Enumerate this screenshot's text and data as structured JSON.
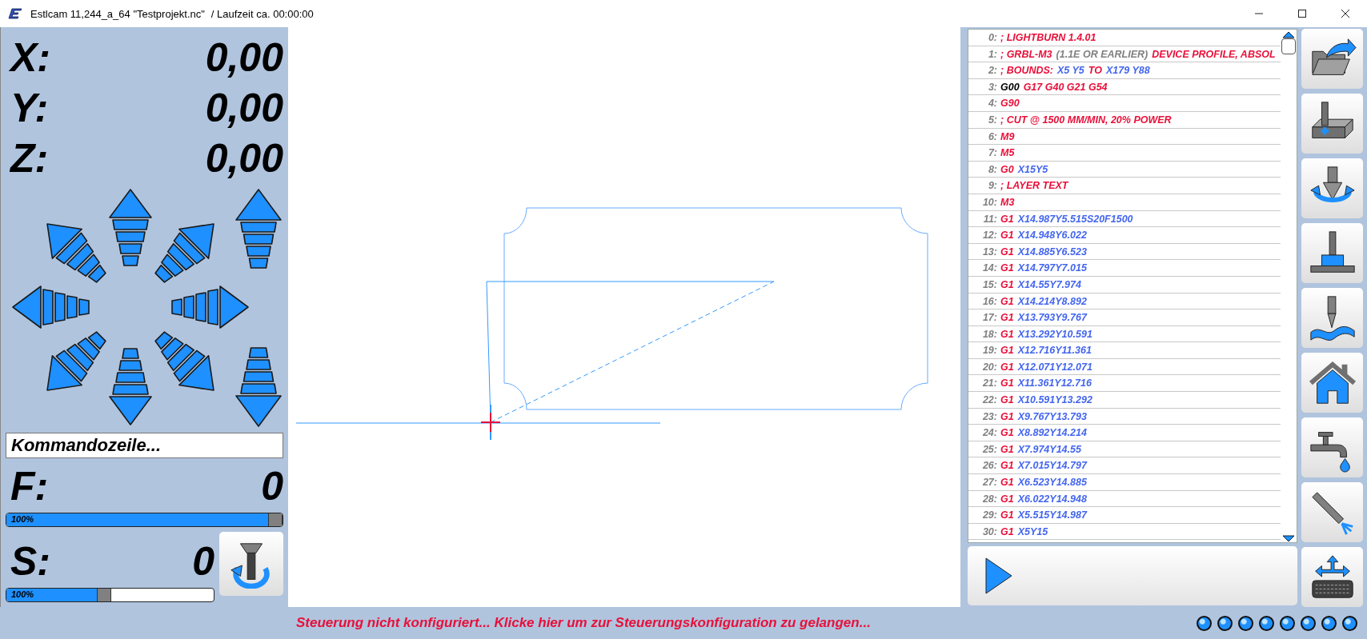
{
  "window": {
    "title": "Estlcam 11,244_a_64 \"Testprojekt.nc\"",
    "runtime": "/ Laufzeit ca. 00:00:00"
  },
  "axes": [
    {
      "label": "X:",
      "value": "0,00"
    },
    {
      "label": "Y:",
      "value": "0,00"
    },
    {
      "label": "Z:",
      "value": "0,00"
    }
  ],
  "command_line": {
    "placeholder": "Kommandozeile..."
  },
  "feed": {
    "label": "F:",
    "value": "0",
    "override": {
      "text": "100%",
      "level": 1.0
    }
  },
  "spindle": {
    "label": "S:",
    "value": "0",
    "override": {
      "text": "100%",
      "level": 0.47
    }
  },
  "gcode": {
    "lines": [
      {
        "number": "0:",
        "parts": [
          {
            "text": "; LIGHTBURN 1.4.01",
            "kind": "code"
          }
        ]
      },
      {
        "number": "1:",
        "parts": [
          {
            "text": "; GRBL-M3",
            "kind": "code"
          },
          {
            "text": "(1.1E OR EARLIER)",
            "kind": "remark"
          },
          {
            "text": "DEVICE PROFILE, ABSOL",
            "kind": "code"
          }
        ]
      },
      {
        "number": "2:",
        "parts": [
          {
            "text": "; BOUNDS:",
            "kind": "code"
          },
          {
            "text": "X5 Y5",
            "kind": "value"
          },
          {
            "text": "TO",
            "kind": "code"
          },
          {
            "text": "X179 Y88",
            "kind": "value"
          }
        ]
      },
      {
        "number": "3:",
        "parts": [
          {
            "text": "G00",
            "kind": "plain"
          },
          {
            "text": "G17 G40 G21 G54",
            "kind": "code"
          }
        ]
      },
      {
        "number": "4:",
        "parts": [
          {
            "text": "G90",
            "kind": "code"
          }
        ]
      },
      {
        "number": "5:",
        "parts": [
          {
            "text": "; CUT @ 1500 MM/MIN, 20% POWER",
            "kind": "code"
          }
        ]
      },
      {
        "number": "6:",
        "parts": [
          {
            "text": "M9",
            "kind": "code"
          }
        ]
      },
      {
        "number": "7:",
        "parts": [
          {
            "text": "M5",
            "kind": "code"
          }
        ]
      },
      {
        "number": "8:",
        "parts": [
          {
            "text": "G0",
            "kind": "code"
          },
          {
            "text": "X15Y5",
            "kind": "value"
          }
        ]
      },
      {
        "number": "9:",
        "parts": [
          {
            "text": "; LAYER TEXT",
            "kind": "code"
          }
        ]
      },
      {
        "number": "10:",
        "parts": [
          {
            "text": "M3",
            "kind": "code"
          }
        ]
      },
      {
        "number": "11:",
        "parts": [
          {
            "text": "G1",
            "kind": "code"
          },
          {
            "text": "X14.987Y5.515S20F1500",
            "kind": "value"
          }
        ]
      },
      {
        "number": "12:",
        "parts": [
          {
            "text": "G1",
            "kind": "code"
          },
          {
            "text": "X14.948Y6.022",
            "kind": "value"
          }
        ]
      },
      {
        "number": "13:",
        "parts": [
          {
            "text": "G1",
            "kind": "code"
          },
          {
            "text": "X14.885Y6.523",
            "kind": "value"
          }
        ]
      },
      {
        "number": "14:",
        "parts": [
          {
            "text": "G1",
            "kind": "code"
          },
          {
            "text": "X14.797Y7.015",
            "kind": "value"
          }
        ]
      },
      {
        "number": "15:",
        "parts": [
          {
            "text": "G1",
            "kind": "code"
          },
          {
            "text": "X14.55Y7.974",
            "kind": "value"
          }
        ]
      },
      {
        "number": "16:",
        "parts": [
          {
            "text": "G1",
            "kind": "code"
          },
          {
            "text": "X14.214Y8.892",
            "kind": "value"
          }
        ]
      },
      {
        "number": "17:",
        "parts": [
          {
            "text": "G1",
            "kind": "code"
          },
          {
            "text": "X13.793Y9.767",
            "kind": "value"
          }
        ]
      },
      {
        "number": "18:",
        "parts": [
          {
            "text": "G1",
            "kind": "code"
          },
          {
            "text": "X13.292Y10.591",
            "kind": "value"
          }
        ]
      },
      {
        "number": "19:",
        "parts": [
          {
            "text": "G1",
            "kind": "code"
          },
          {
            "text": "X12.716Y11.361",
            "kind": "value"
          }
        ]
      },
      {
        "number": "20:",
        "parts": [
          {
            "text": "G1",
            "kind": "code"
          },
          {
            "text": "X12.071Y12.071",
            "kind": "value"
          }
        ]
      },
      {
        "number": "21:",
        "parts": [
          {
            "text": "G1",
            "kind": "code"
          },
          {
            "text": "X11.361Y12.716",
            "kind": "value"
          }
        ]
      },
      {
        "number": "22:",
        "parts": [
          {
            "text": "G1",
            "kind": "code"
          },
          {
            "text": "X10.591Y13.292",
            "kind": "value"
          }
        ]
      },
      {
        "number": "23:",
        "parts": [
          {
            "text": "G1",
            "kind": "code"
          },
          {
            "text": "X9.767Y13.793",
            "kind": "value"
          }
        ]
      },
      {
        "number": "24:",
        "parts": [
          {
            "text": "G1",
            "kind": "code"
          },
          {
            "text": "X8.892Y14.214",
            "kind": "value"
          }
        ]
      },
      {
        "number": "25:",
        "parts": [
          {
            "text": "G1",
            "kind": "code"
          },
          {
            "text": "X7.974Y14.55",
            "kind": "value"
          }
        ]
      },
      {
        "number": "26:",
        "parts": [
          {
            "text": "G1",
            "kind": "code"
          },
          {
            "text": "X7.015Y14.797",
            "kind": "value"
          }
        ]
      },
      {
        "number": "27:",
        "parts": [
          {
            "text": "G1",
            "kind": "code"
          },
          {
            "text": "X6.523Y14.885",
            "kind": "value"
          }
        ]
      },
      {
        "number": "28:",
        "parts": [
          {
            "text": "G1",
            "kind": "code"
          },
          {
            "text": "X6.022Y14.948",
            "kind": "value"
          }
        ]
      },
      {
        "number": "29:",
        "parts": [
          {
            "text": "G1",
            "kind": "code"
          },
          {
            "text": "X5.515Y14.987",
            "kind": "value"
          }
        ]
      },
      {
        "number": "30:",
        "parts": [
          {
            "text": "G1",
            "kind": "code"
          },
          {
            "text": "X5Y15",
            "kind": "value"
          }
        ]
      }
    ]
  },
  "status": {
    "message": "Steuerung nicht konfiguriert... Klicke hier um zur Steuerungskonfiguration zu gelangen..."
  }
}
